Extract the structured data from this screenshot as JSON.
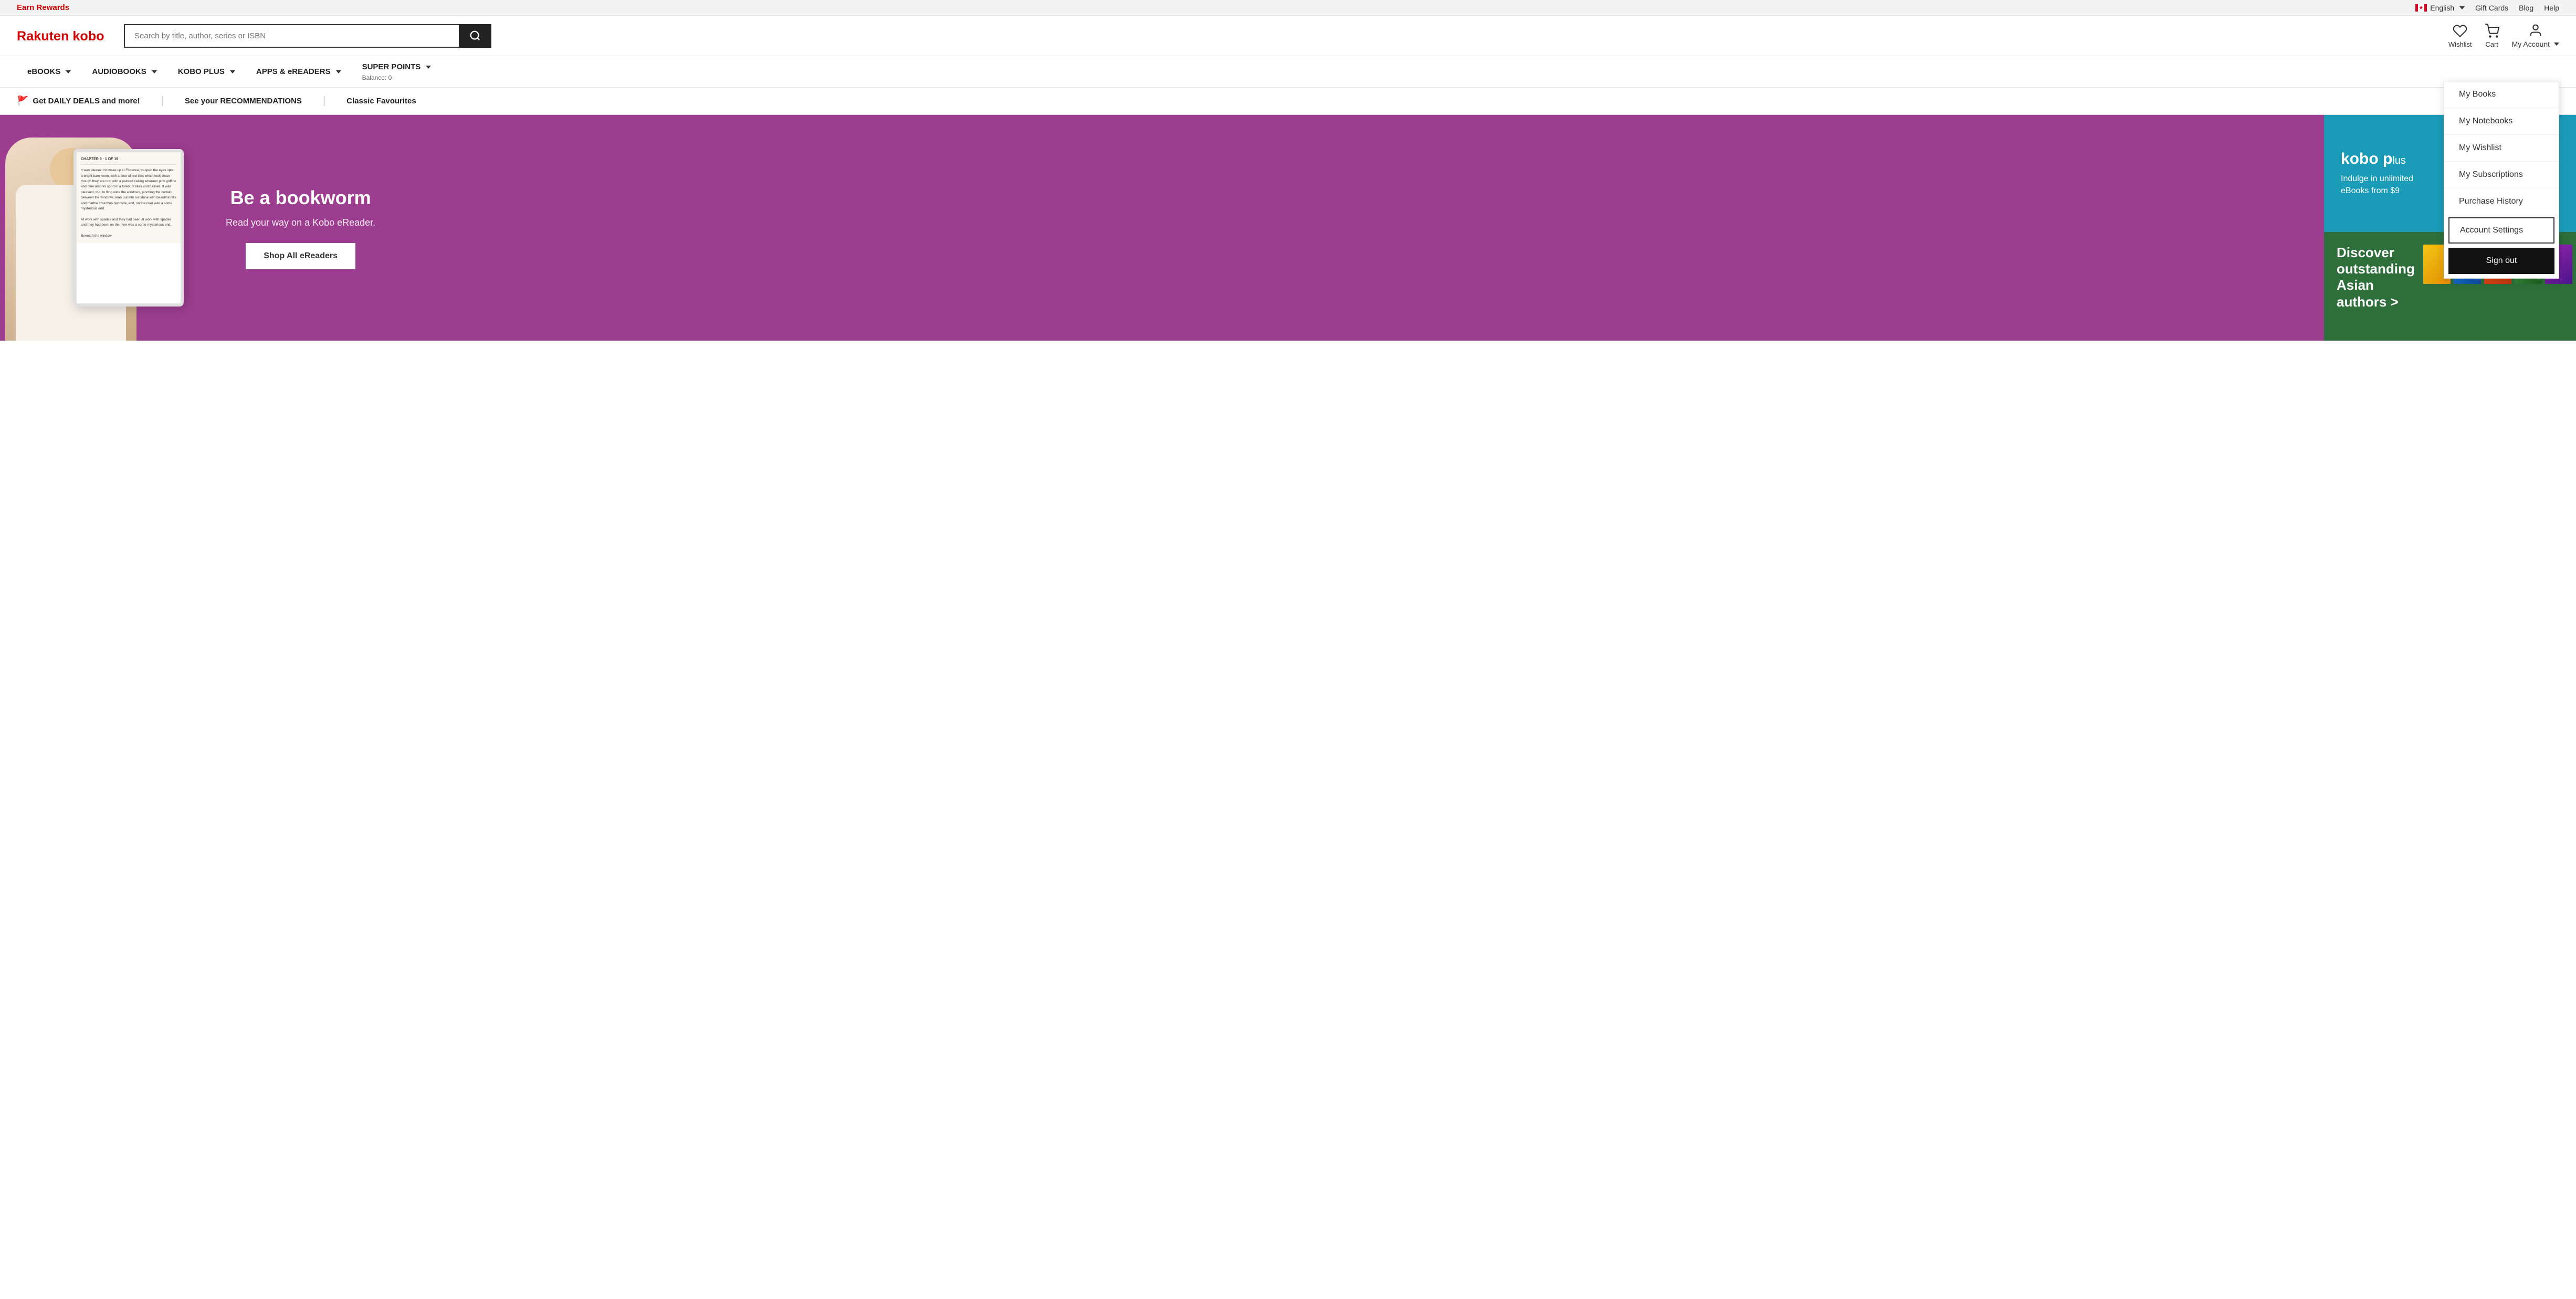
{
  "topbar": {
    "earn_rewards": "Earn Rewards",
    "language": "English",
    "gift_cards": "Gift Cards",
    "blog": "Blog",
    "help": "Help"
  },
  "header": {
    "logo_text": "Rakuten kobo",
    "search_placeholder": "Search by title, author, series or ISBN",
    "wishlist_label": "Wishlist",
    "cart_label": "Cart",
    "my_account_label": "My Account"
  },
  "nav": {
    "items": [
      {
        "label": "eBOOKS",
        "has_dropdown": true
      },
      {
        "label": "AUDIOBOOKS",
        "has_dropdown": true
      },
      {
        "label": "KOBO PLUS",
        "has_dropdown": true
      },
      {
        "label": "APPS & eREADERS",
        "has_dropdown": true
      },
      {
        "label": "SUPER POINTS",
        "has_dropdown": true,
        "sub": "Balance: 0"
      }
    ]
  },
  "promobar": {
    "daily_deals": "Get DAILY DEALS and more!",
    "recommendations": "See your RECOMMENDATIONS",
    "classic_favourites": "Classic Favourites"
  },
  "account_dropdown": {
    "items": [
      {
        "label": "My Books",
        "key": "my-books"
      },
      {
        "label": "My Notebooks",
        "key": "my-notebooks"
      },
      {
        "label": "My Wishlist",
        "key": "my-wishlist"
      },
      {
        "label": "My Subscriptions",
        "key": "my-subscriptions"
      },
      {
        "label": "Purchase History",
        "key": "purchase-history"
      }
    ],
    "account_settings": "Account Settings",
    "sign_out": "Sign out"
  },
  "hero": {
    "title": "Be a bookworm",
    "subtitle": "Read your way on a Kobo eReader.",
    "cta": "Shop All eReaders",
    "right_top_title": "kobo p",
    "right_top_subtitle": "Indulge in unlimited eBooks from $9",
    "right_bottom_title": "Discover outstanding Asian authors >"
  },
  "device_text": "CHAPTER 9 · 1 OF 19\n\nIt was pleasant to wake up in Florence, to open the eyes upon a bright bare room, with a floor of red tiles which look clean though they are not; with a painted ceiling whereon pink griffins and blue amorini sport in a forest of lilies and basses. It was pleasant, too, to fling wide the windows, pinching the curtain between the windows, lean out into sunshine with beautiful hills and marble churches opposite, and, on the river was a some mysterious end.\n\nAt work with spades and they had been at work with spades and they had been on the river was a some mysterious end.\n\nBeneath the window"
}
